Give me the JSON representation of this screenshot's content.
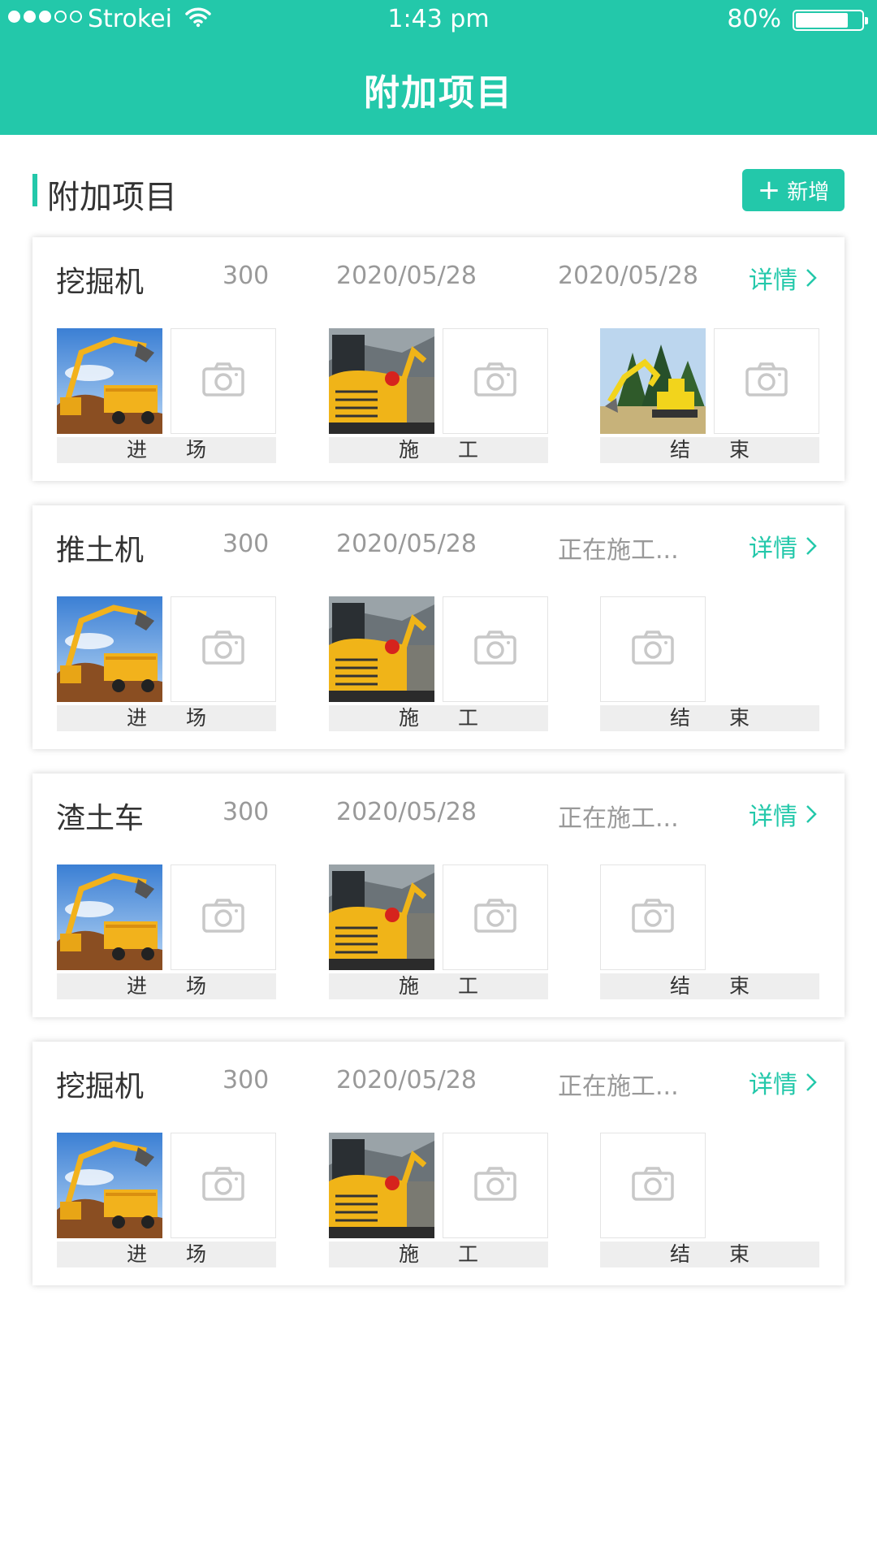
{
  "status_bar": {
    "carrier": "Strokei",
    "time": "1:43 pm",
    "battery_percent": "80%",
    "battery_level": 0.8,
    "signal_dots_filled": 3,
    "signal_dots_total": 5
  },
  "header": {
    "title": "附加项目"
  },
  "section": {
    "title": "附加项目",
    "add_button_label": "新增"
  },
  "stage_labels": [
    "进 场",
    "施 工",
    "结 束"
  ],
  "cards": [
    {
      "name": "挖掘机",
      "price": "300",
      "start_date": "2020/05/28",
      "end_status": "2020/05/28",
      "detail_label": "详情",
      "photos": [
        [
          "dump-truck-photo",
          null
        ],
        [
          "excavator-closeup-photo",
          null
        ],
        [
          "yellow-excavator-photo",
          null
        ]
      ]
    },
    {
      "name": "推土机",
      "price": "300",
      "start_date": "2020/05/28",
      "end_status": "正在施工...",
      "detail_label": "详情",
      "photos": [
        [
          "dump-truck-photo",
          null
        ],
        [
          "excavator-closeup-photo",
          null
        ],
        [
          null
        ]
      ]
    },
    {
      "name": "渣土车",
      "price": "300",
      "start_date": "2020/05/28",
      "end_status": "正在施工...",
      "detail_label": "详情",
      "photos": [
        [
          "dump-truck-photo",
          null
        ],
        [
          "excavator-closeup-photo",
          null
        ],
        [
          null
        ]
      ]
    },
    {
      "name": "挖掘机",
      "price": "300",
      "start_date": "2020/05/28",
      "end_status": "正在施工...",
      "detail_label": "详情",
      "photos": [
        [
          "dump-truck-photo",
          null
        ],
        [
          "excavator-closeup-photo",
          null
        ],
        [
          null
        ]
      ]
    }
  ],
  "colors": {
    "accent": "#23c8aa",
    "muted_text": "#999999",
    "stage_bg": "#eeeeee"
  }
}
